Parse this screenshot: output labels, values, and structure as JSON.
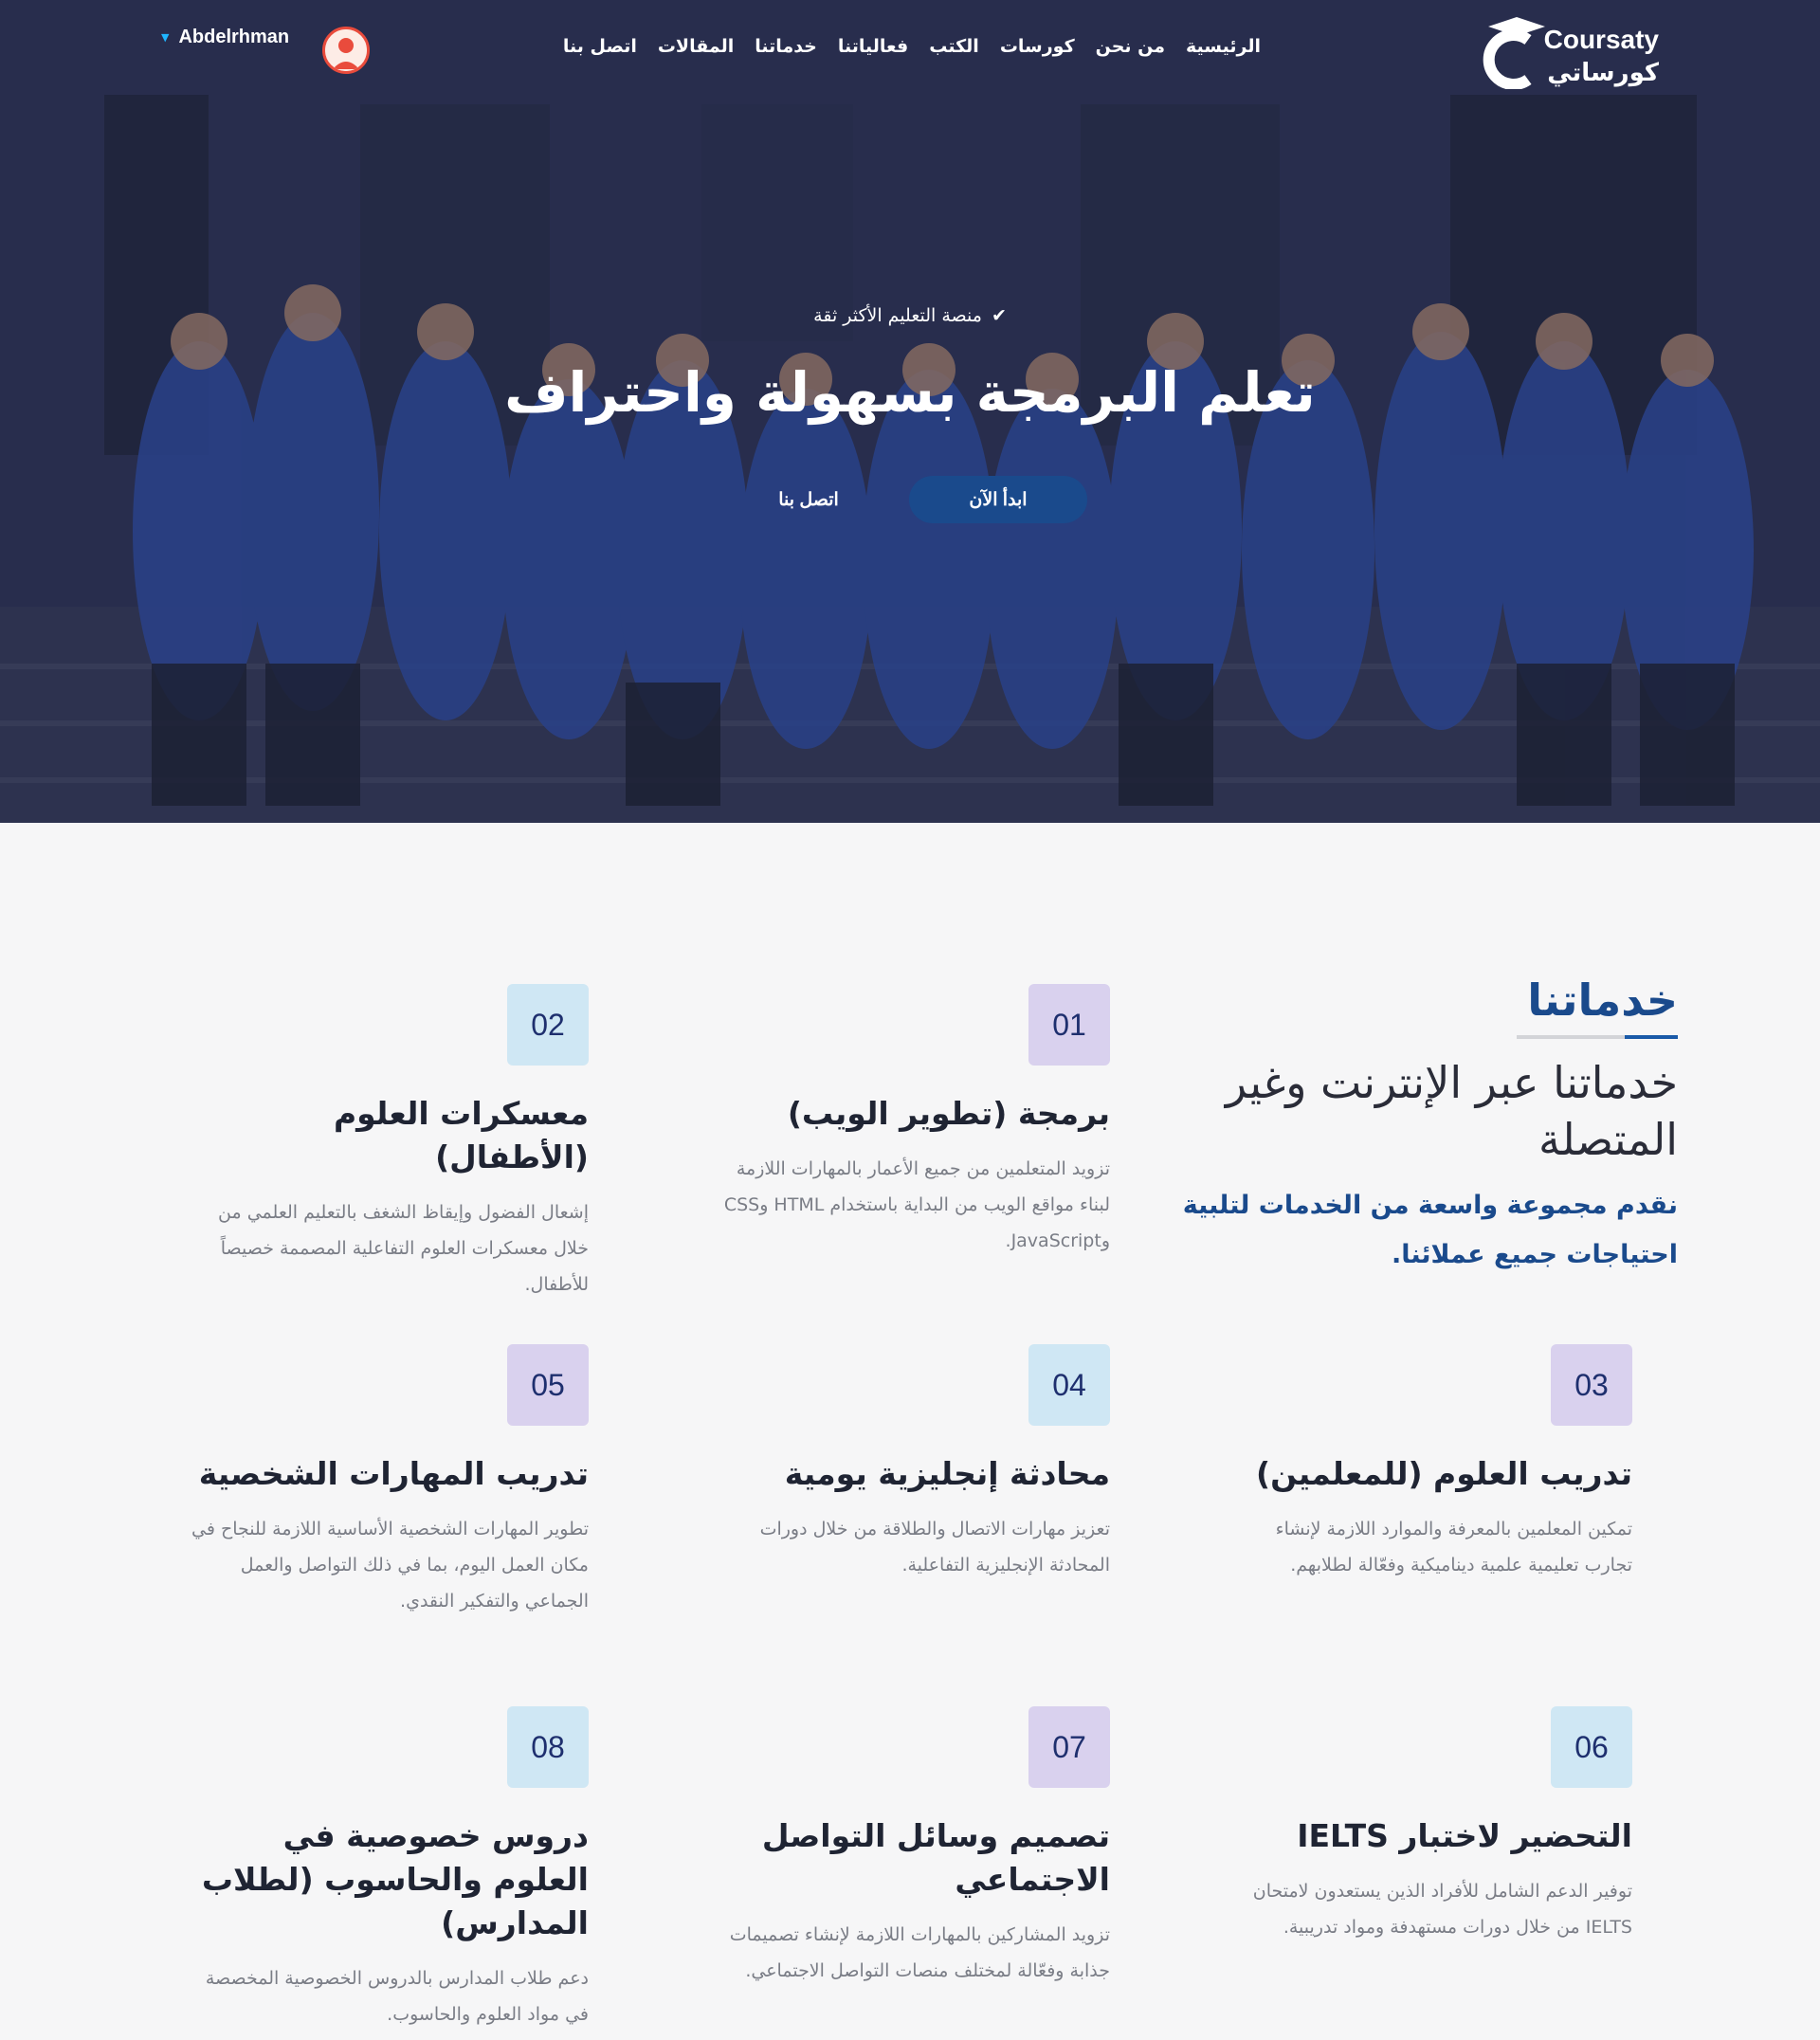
{
  "brand": {
    "name_en": "Coursaty",
    "name_ar": "كورساتي"
  },
  "nav": [
    "الرئيسية",
    "من نحن",
    "كورسات",
    "الكتب",
    "فعالياتنا",
    "خدماتنا",
    "المقالات",
    "اتصل بنا"
  ],
  "user": {
    "name": "Abdelrhman"
  },
  "hero": {
    "badge": "منصة التعليم الأكثر ثقة",
    "title": "تعلم البرمجة بسهولة واحتراف",
    "primary_cta": "ابدأ الآن",
    "secondary_cta": "اتصل بنا"
  },
  "services": {
    "kicker": "خدماتنا",
    "heading": "خدماتنا عبر الإنترنت وغير المتصلة",
    "subheading": "نقدم مجموعة واسعة من الخدمات لتلبية احتياجات جميع عملائنا.",
    "items": [
      {
        "num": "01",
        "title": "برمجة (تطوير الويب)",
        "desc": "تزويد المتعلمين من جميع الأعمار بالمهارات اللازمة لبناء مواقع الويب من البداية باستخدام HTML وCSS وJavaScript.",
        "tone": "purple"
      },
      {
        "num": "02",
        "title": "معسكرات العلوم (الأطفال)",
        "desc": "إشعال الفضول وإيقاظ الشغف بالتعليم العلمي من خلال معسكرات العلوم التفاعلية المصممة خصيصاً للأطفال.",
        "tone": "blue"
      },
      {
        "num": "03",
        "title": "تدريب العلوم (للمعلمين)",
        "desc": "تمكين المعلمين بالمعرفة والموارد اللازمة لإنشاء تجارب تعليمية علمية ديناميكية وفعّالة لطلابهم.",
        "tone": "purple"
      },
      {
        "num": "04",
        "title": "محادثة إنجليزية يومية",
        "desc": "تعزيز مهارات الاتصال والطلاقة من خلال دورات المحادثة الإنجليزية التفاعلية.",
        "tone": "blue"
      },
      {
        "num": "05",
        "title": "تدريب المهارات الشخصية",
        "desc": "تطوير المهارات الشخصية الأساسية اللازمة للنجاح في مكان العمل اليوم، بما في ذلك التواصل والعمل الجماعي والتفكير النقدي.",
        "tone": "purple"
      },
      {
        "num": "06",
        "title": "التحضير لاختبار IELTS",
        "desc": "توفير الدعم الشامل للأفراد الذين يستعدون لامتحان IELTS من خلال دورات مستهدفة ومواد تدريبية.",
        "tone": "blue"
      },
      {
        "num": "07",
        "title": "تصميم وسائل التواصل الاجتماعي",
        "desc": "تزويد المشاركين بالمهارات اللازمة لإنشاء تصميمات جذابة وفعّالة لمختلف منصات التواصل الاجتماعي.",
        "tone": "purple"
      },
      {
        "num": "08",
        "title": "دروس خصوصية في العلوم والحاسوب (لطلاب المدارس)",
        "desc": "دعم طلاب المدارس بالدروس الخصوصية المخصصة في مواد العلوم والحاسوب.",
        "tone": "blue"
      }
    ]
  },
  "colors": {
    "primary": "#1a4a8c",
    "accent_blue": "#cfe7f4",
    "accent_purple": "#d9d1ee",
    "avatar_ring": "#e94b3c"
  }
}
